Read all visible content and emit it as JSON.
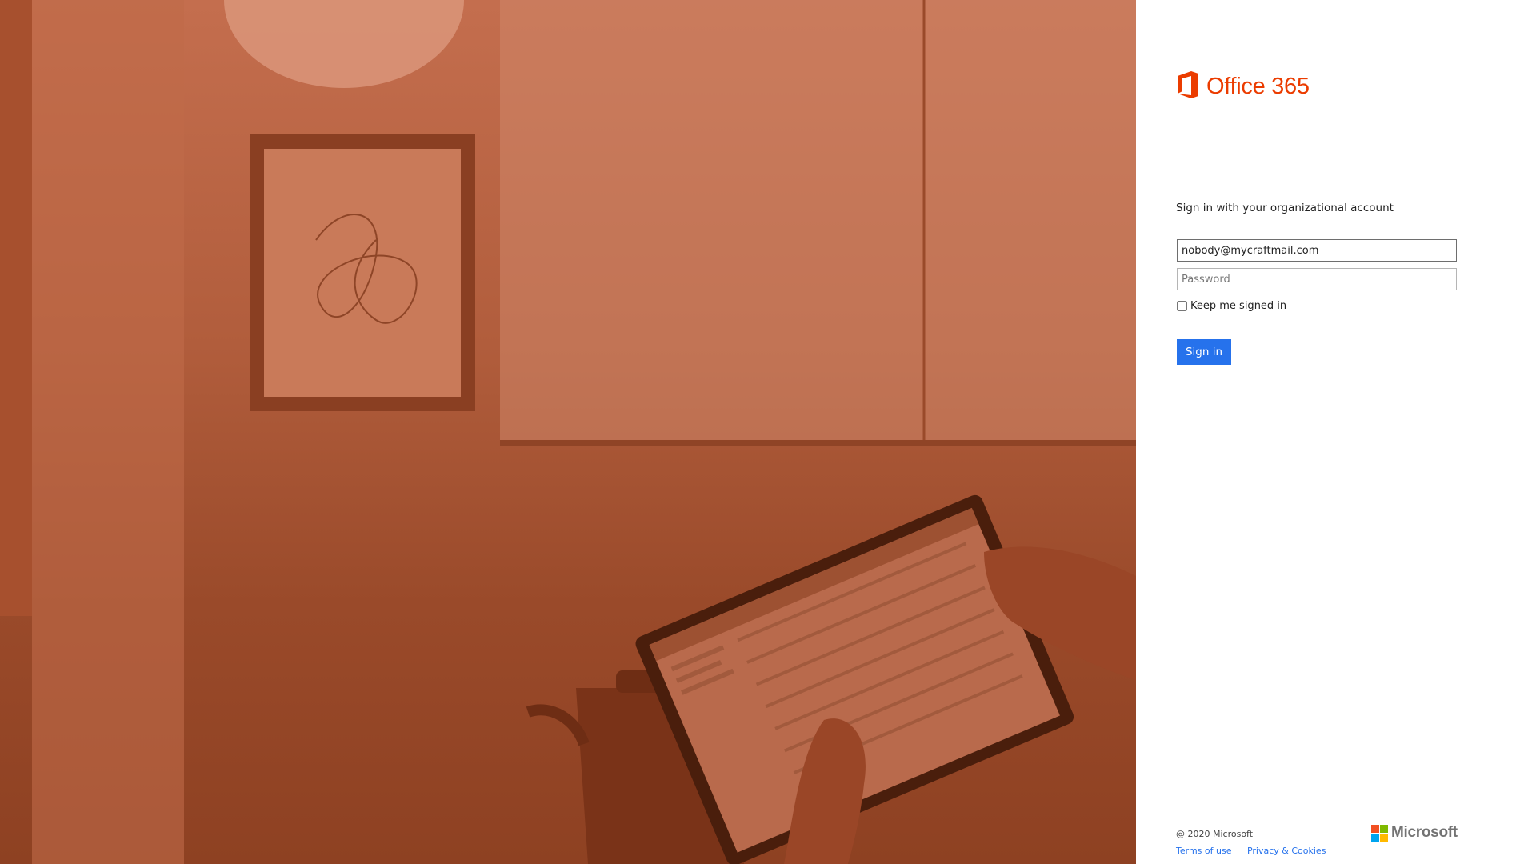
{
  "brand": {
    "product_name": "Office 365",
    "accent_color": "#eb3c00",
    "icon": "office-logo-icon"
  },
  "signin": {
    "heading": "Sign in with your organizational account",
    "email_value": "nobody@mycraftmail.com",
    "password_placeholder": "Password",
    "keep_signed_in_label": "Keep me signed in",
    "keep_signed_in_checked": false,
    "button_label": "Sign in",
    "button_color": "#2672ec"
  },
  "footer": {
    "copyright": "@ 2020 Microsoft",
    "links": [
      {
        "label": "Terms of use"
      },
      {
        "label": "Privacy & Cookies"
      }
    ],
    "vendor_name": "Microsoft",
    "vendor_logo_colors": [
      "#f25022",
      "#7fba00",
      "#00a4ef",
      "#ffb900"
    ]
  },
  "background": {
    "tint_color": "#b15d3c",
    "scene": "room-with-tablet-illustration"
  }
}
